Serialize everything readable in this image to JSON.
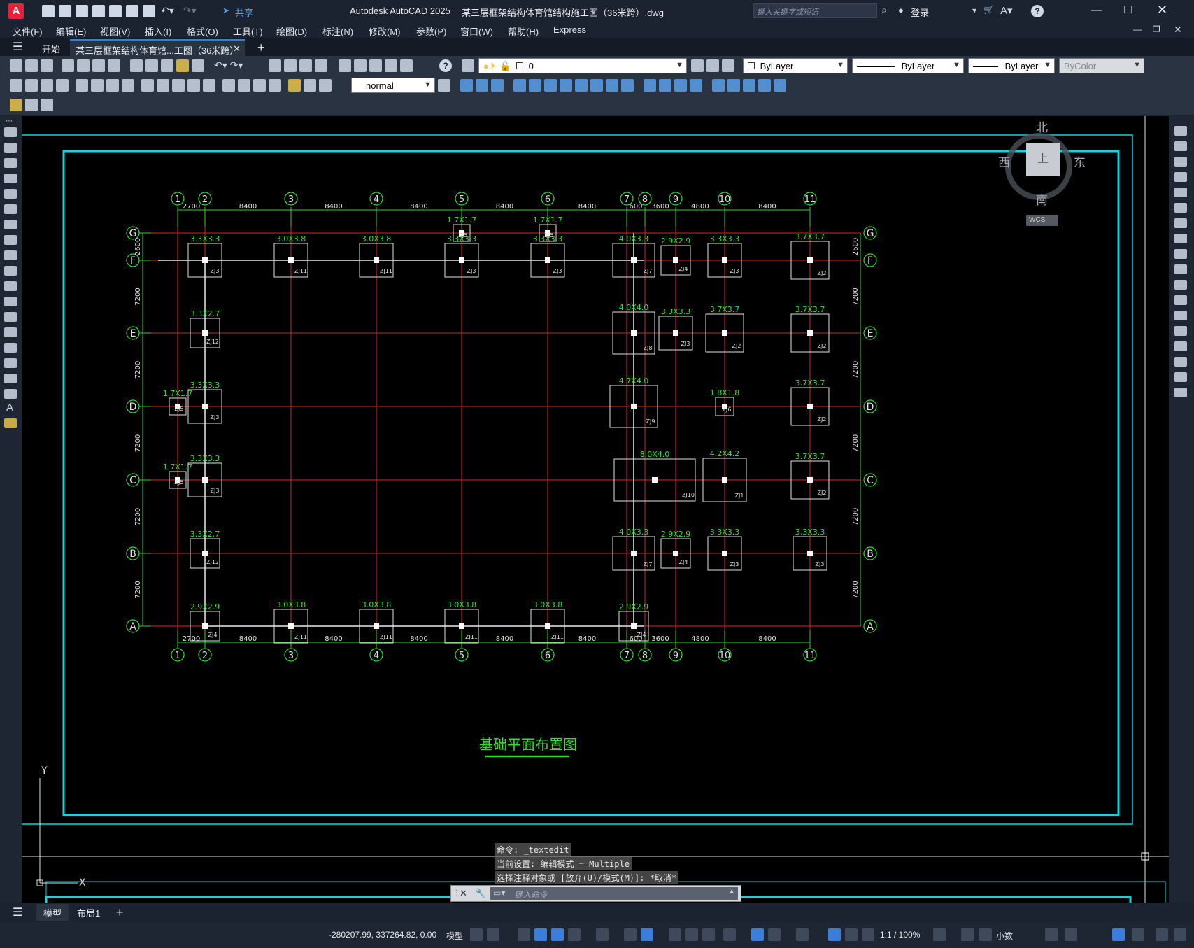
{
  "app": {
    "title": "Autodesk AutoCAD 2025",
    "file_title": "某三层框架结构体育馆结构施工图（36米跨）.dwg",
    "search_placeholder": "键入关键字或短语",
    "login": "登录",
    "share": "共享",
    "help_label": "?"
  },
  "menu": [
    "文件(F)",
    "编辑(E)",
    "视图(V)",
    "插入(I)",
    "格式(O)",
    "工具(T)",
    "绘图(D)",
    "标注(N)",
    "修改(M)",
    "参数(P)",
    "窗口(W)",
    "帮助(H)",
    "Express"
  ],
  "tabs": {
    "start": "开始",
    "doc": "某三层框架结构体育馆...工图（36米跨）*",
    "add": "+"
  },
  "toolbar": {
    "layer_value": "0",
    "text_style": "normal",
    "color": "ByLayer",
    "linetype": "ByLayer",
    "lineweight": "ByLayer",
    "plotstyle": "ByColor"
  },
  "viewcube": {
    "north": "北",
    "south": "南",
    "east": "东",
    "west": "西",
    "top": "上",
    "wcs": "WCS"
  },
  "drawing": {
    "title": "基础平面布置图",
    "row_axes": [
      "G",
      "F",
      "E",
      "D",
      "C",
      "B",
      "A"
    ],
    "col_axes": [
      "1",
      "2",
      "3",
      "4",
      "5",
      "6",
      "7",
      "8",
      "9",
      "10",
      "11"
    ],
    "top_dims": [
      "2700",
      "8400",
      "8400",
      "8400",
      "8400",
      "8400",
      "600",
      "3600",
      "4800",
      "8400"
    ],
    "left_dims": [
      "2600",
      "7200",
      "7200",
      "7200",
      "7200",
      "7200"
    ],
    "footings": [
      {
        "size": "3.3X3.3",
        "tag": "ZJ3"
      },
      {
        "size": "3.0X3.8",
        "tag": "ZJ11"
      },
      {
        "size": "3.0X3.8",
        "tag": "ZJ11"
      },
      {
        "size": "3.3X3.3",
        "tag": "ZJ3"
      },
      {
        "size": "3.3X3.3",
        "tag": "ZJ3"
      },
      {
        "size": "4.0X3.3",
        "tag": "ZJ7"
      },
      {
        "size": "2.9X2.9",
        "tag": "ZJ4"
      },
      {
        "size": "3.3X3.3",
        "tag": "ZJ3"
      },
      {
        "size": "3.7X3.7",
        "tag": "ZJ2"
      },
      {
        "size": "1.7X1.7",
        "tag": "ZJ5"
      },
      {
        "size": "3.3X2.7",
        "tag": "ZJ12"
      },
      {
        "size": "4.0X4.0",
        "tag": "ZJ8"
      },
      {
        "size": "3.7X3.7",
        "tag": "ZJ2"
      },
      {
        "size": "4.7X4.0",
        "tag": "ZJ9"
      },
      {
        "size": "1.8X1.8",
        "tag": "ZJ6"
      },
      {
        "size": "8.0X4.0",
        "tag": "ZJ10"
      },
      {
        "size": "4.2X4.2",
        "tag": "ZJ1"
      },
      {
        "size": "2.9X2.9",
        "tag": "ZJ4"
      }
    ]
  },
  "command": {
    "history": [
      "命令: _textedit",
      "当前设置: 编辑模式 = Multiple",
      "选择注释对象或 [放弃(U)/模式(M)]: *取消*"
    ],
    "placeholder": "键入命令"
  },
  "layout_tabs": [
    "模型",
    "布局1"
  ],
  "status": {
    "coords": "-280207.99, 337264.82, 0.00",
    "model": "模型",
    "scale": "1:1 / 100%",
    "units": "小数"
  }
}
